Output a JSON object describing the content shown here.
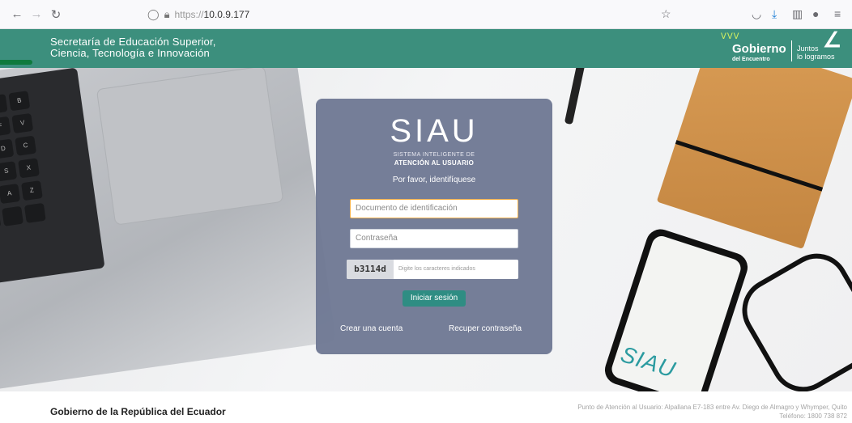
{
  "browser": {
    "url_protocol": "https://",
    "url_host": "10.0.9.177",
    "icons": [
      "back-icon",
      "forward-icon",
      "reload-icon",
      "shield-icon",
      "lock-icon",
      "star-icon",
      "pocket-icon",
      "download-icon",
      "library-icon",
      "extension-icon",
      "menu-icon"
    ]
  },
  "header": {
    "title_line1": "Secretaría de Educación Superior,",
    "title_line2": "Ciencia, Tecnología e Innovación",
    "gov_logo": {
      "main": "Gobierno",
      "sub": "del Encuentro",
      "tag_line1": "Juntos",
      "tag_line2": "lo logramos"
    },
    "colors": {
      "background": "#3c8f7d"
    }
  },
  "login": {
    "logo": "SIAU",
    "logo_sub1": "SISTEMA INTELIGENTE DE",
    "logo_sub2": "ATENCIÓN AL USUARIO",
    "prompt": "Por favor, identifíquese",
    "document_placeholder": "Documento de identificación",
    "password_placeholder": "Contraseña",
    "captcha_code": "b3114d",
    "captcha_placeholder": "Digite los caracteres indicados",
    "submit_label": "Iniciar sesión",
    "create_account": "Crear una cuenta",
    "recover_password": "Recuper contraseña",
    "colors": {
      "card": "#6f7994",
      "button": "#2f8d83"
    }
  },
  "hero": {
    "phone_text": "SIAU"
  },
  "footer": {
    "title": "Gobierno de la República del Ecuador",
    "address_line1": "Punto de Atención al Usuario: Alpallana E7-183 entre Av. Diego de Almagro y Whymper, Quito",
    "address_line2": "Teléfono: 1800 738 872"
  }
}
